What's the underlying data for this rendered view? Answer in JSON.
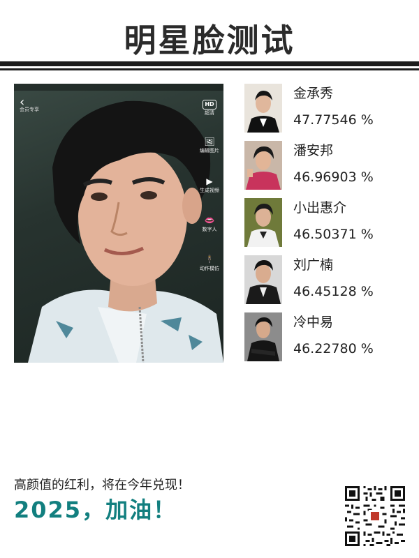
{
  "header": {
    "title": "明星脸测试"
  },
  "photo": {
    "vip_label": "会员专享",
    "tools": [
      {
        "icon": "hd-icon",
        "glyph": "HD",
        "label": "超清"
      },
      {
        "icon": "image-edit-icon",
        "glyph": "🖼",
        "label": "编辑图片"
      },
      {
        "icon": "video-icon",
        "glyph": "▶",
        "label": "生成视频"
      },
      {
        "icon": "lips-icon",
        "glyph": "👄",
        "label": "数字人"
      },
      {
        "icon": "figure-icon",
        "glyph": "🕴",
        "label": "动作模仿"
      }
    ]
  },
  "results": [
    {
      "name": "金承秀",
      "score": "47.77546 %"
    },
    {
      "name": "潘安邦",
      "score": "46.96903 %"
    },
    {
      "name": "小出惠介",
      "score": "46.50371 %"
    },
    {
      "name": "刘广楠",
      "score": "46.45128 %"
    },
    {
      "name": "冷中易",
      "score": "46.22780 %"
    }
  ],
  "footer": {
    "line1": "高颜值的红利，将在今年兑现！",
    "line2": "2025，加油！"
  },
  "colors": {
    "accent": "#127f7f",
    "rule": "#1c1c1c"
  }
}
